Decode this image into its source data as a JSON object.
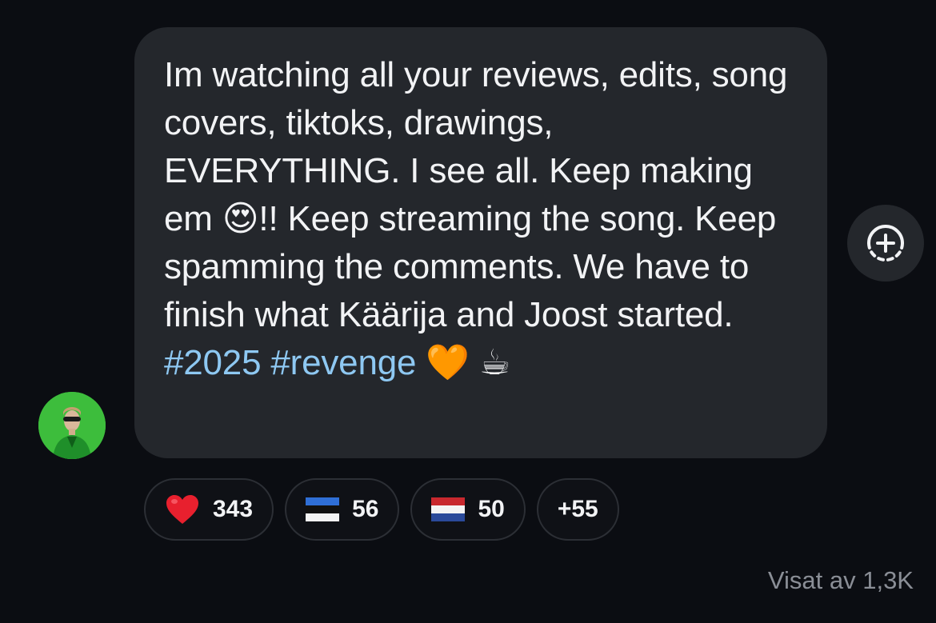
{
  "message": {
    "part1": "Im watching all your reviews, edits, song covers, tiktoks, drawings, EVERYTHING. I see all. Keep making em ",
    "emoji1": "😍",
    "part2": "!! Keep streaming the song. Keep spamming the comments. We have to finish what Käärija and Joost started. ",
    "hashtag1": "#2025",
    "hashtag2": "#revenge",
    "emoji2": "🧡",
    "emoji3": "☕"
  },
  "add_reaction": {
    "icon": "add-reaction-icon"
  },
  "reactions": [
    {
      "icon": "red-heart-icon",
      "count": "343"
    },
    {
      "icon": "estonia-flag-icon",
      "count": "56"
    },
    {
      "icon": "netherlands-flag-icon",
      "count": "50"
    },
    {
      "count": "+55"
    }
  ],
  "seen_by": "Visat av 1,3K",
  "colors": {
    "background": "#0b0d12",
    "bubble": "#24272c",
    "hashtag": "#8ec8f2",
    "text": "#f2f3f5",
    "muted": "#8a8e96"
  }
}
